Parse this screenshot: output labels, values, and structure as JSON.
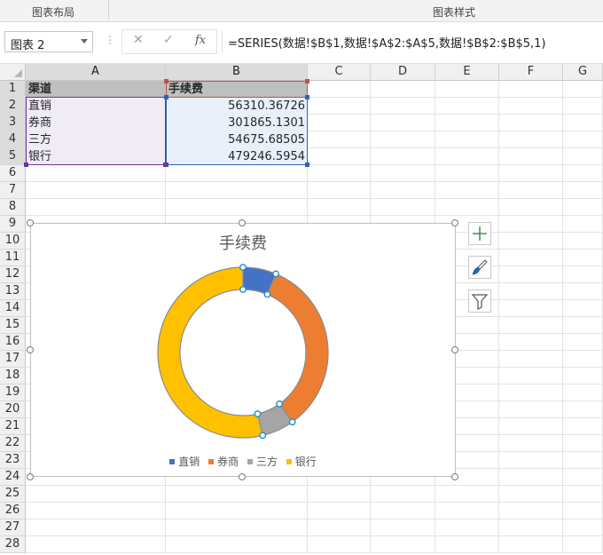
{
  "ribbon": {
    "group_labels": [
      "图表布局",
      "图表样式"
    ]
  },
  "formula_bar": {
    "name_box": "图表 2",
    "cancel_symbol": "✕",
    "enter_symbol": "✓",
    "fx_label": "fx",
    "formula": "=SERIES(数据!$B$1,数据!$A$2:$A$5,数据!$B$2:$B$5,1)"
  },
  "sheet": {
    "columns": [
      "A",
      "B",
      "C",
      "D",
      "E",
      "F",
      "G"
    ],
    "rows": [
      "1",
      "2",
      "3",
      "4",
      "5",
      "6",
      "7",
      "8",
      "9",
      "10",
      "11",
      "12",
      "13",
      "14",
      "15",
      "16",
      "17",
      "18",
      "19",
      "20",
      "21",
      "22",
      "23",
      "24",
      "25",
      "26",
      "27",
      "28"
    ],
    "header": [
      "渠道",
      "手续费"
    ],
    "data": [
      [
        "直销",
        "56310.36726"
      ],
      [
        "券商",
        "301865.1301"
      ],
      [
        "三方",
        "54675.68505"
      ],
      [
        "银行",
        "479246.5954"
      ]
    ]
  },
  "chart": {
    "name": "图表 2",
    "chart_data": {
      "type": "pie",
      "subtype": "doughnut",
      "title": "手续费",
      "categories": [
        "直销",
        "券商",
        "三方",
        "银行"
      ],
      "values": [
        56310.36726,
        301865.1301,
        54675.68505,
        479246.5954
      ],
      "colors": [
        "#4472c4",
        "#ed7d31",
        "#a5a5a5",
        "#ffc000"
      ],
      "legend_position": "bottom",
      "start_angle_deg": 0
    },
    "side_buttons": [
      "plus-icon",
      "brush-icon",
      "filter-icon"
    ]
  },
  "colors": {
    "header_fill": "#bfbfbf",
    "range_a_border": "#7030a0",
    "range_b_border": "#2f64b5",
    "range_a_fill": "#f0ecf6",
    "range_b_fill": "#eaf0fa",
    "header_b_border": "#c0504d",
    "chart_plus": "#2e8b3a",
    "chart_brush": "#2f64b5"
  }
}
